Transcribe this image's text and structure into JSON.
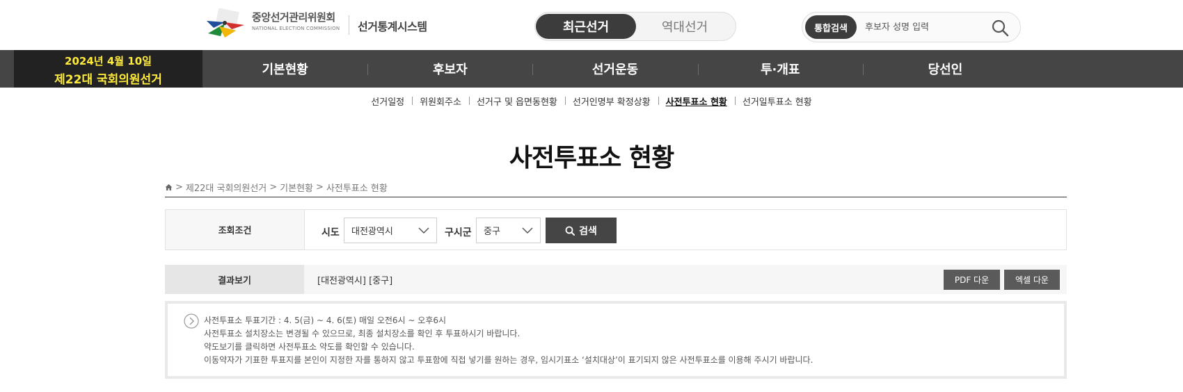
{
  "header": {
    "org_name_ko": "중앙선거관리위원회",
    "org_name_en": "NATIONAL ELECTION COMMISSION",
    "system_name": "선거통계시스템",
    "toggle": {
      "recent": "최근선거",
      "past": "역대선거"
    },
    "search": {
      "tag": "통합검색",
      "placeholder": "후보자 성명 입력"
    }
  },
  "election": {
    "date": "2024년 4월 10일",
    "name": "제22대 국회의원선거"
  },
  "menu": [
    "기본현황",
    "후보자",
    "선거운동",
    "투·개표",
    "당선인"
  ],
  "subnav": [
    "선거일정",
    "위원회주소",
    "선거구 및 읍면동현황",
    "선거인명부 확정상황",
    "사전투표소 현황",
    "선거일투표소 현황"
  ],
  "page_title": "사전투표소 현황",
  "breadcrumb": [
    "제22대 국회의원선거",
    "기본현황",
    "사전투표소 현황"
  ],
  "filter": {
    "label": "조회조건",
    "sido_label": "시도",
    "sido_value": "대전광역시",
    "sigungu_label": "구시군",
    "sigungu_value": "중구",
    "search_button": "검색"
  },
  "result": {
    "label": "결과보기",
    "text": "[대전광역시] [중구]",
    "pdf_button": "PDF 다운",
    "excel_button": "엑셀 다운"
  },
  "notice": [
    "사전투표소 투표기간 : 4. 5(금) ~ 4. 6(토) 매일 오전6시 ~ 오후6시",
    "사전투표소 설치장소는 변경될 수 있으므로, 최종 설치장소를 확인 후 투표하시기 바랍니다.",
    "약도보기를 클릭하면 사전투표소 약도를 확인할 수 있습니다.",
    "이동약자가 기표한 투표지를 본인이 지정한 자를 통하지 않고 투표함에 직접 넣기를 원하는 경우, 임시기표소 ‘설치대상’이 표기되지 않은 사전투표소를 이용해 주시기 바랍니다."
  ],
  "colors": {
    "nav_bg": "#454545",
    "election_bg": "#222222",
    "election_text": "#ffeb3b"
  }
}
